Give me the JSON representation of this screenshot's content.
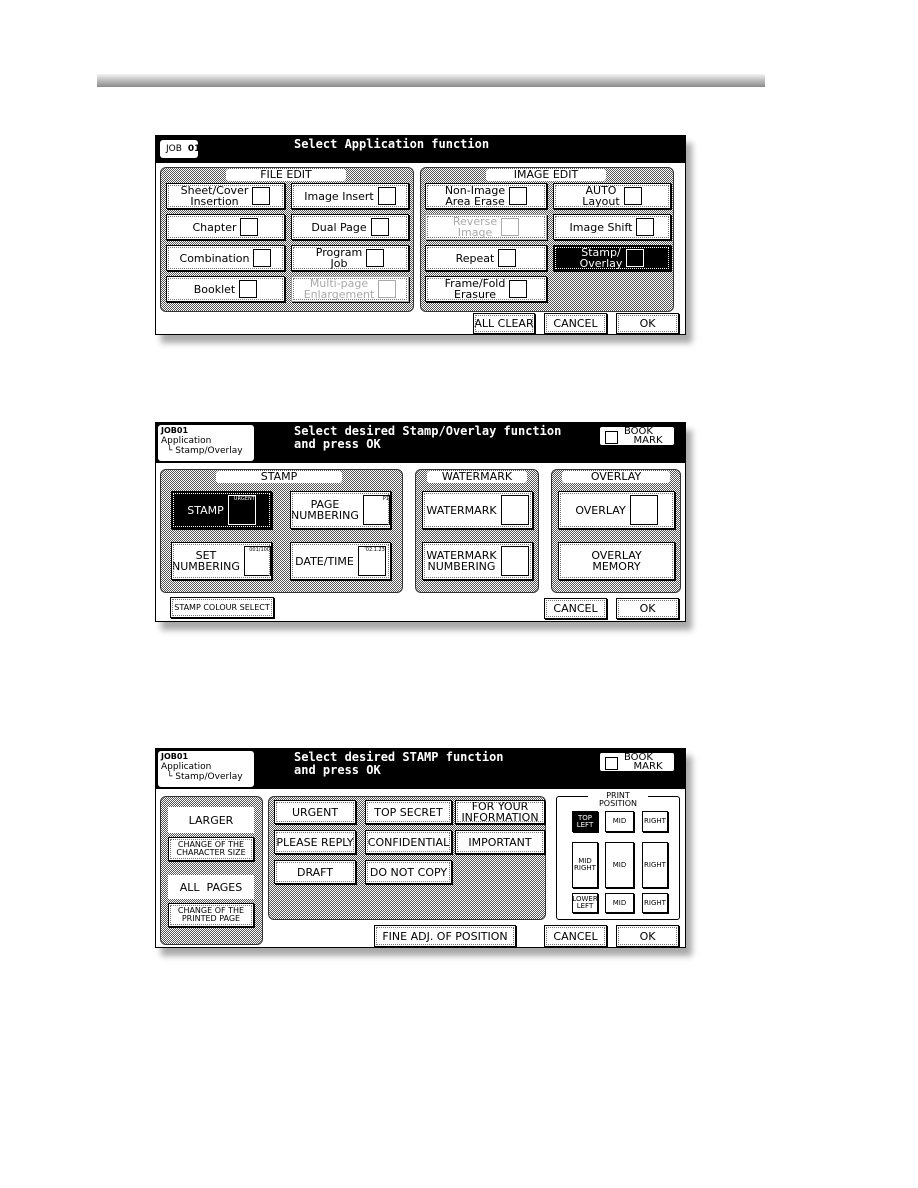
{
  "screen1": {
    "job_label": "JOB",
    "job_number": "01",
    "title": "Select Application function",
    "file_edit_label": "FILE EDIT",
    "image_edit_label": "IMAGE EDIT",
    "buttons": [
      {
        "label": "Sheet/Cover\nInsertion",
        "icon": "sheet-cover-icon",
        "state": "normal"
      },
      {
        "label": "Image Insert",
        "icon": "image-insert-icon",
        "state": "normal"
      },
      {
        "label": "Chapter",
        "icon": "chapter-icon",
        "state": "normal"
      },
      {
        "label": "Dual Page",
        "icon": "dual-page-icon",
        "state": "normal"
      },
      {
        "label": "Combination",
        "icon": "combination-icon",
        "state": "normal"
      },
      {
        "label": "Program\nJob",
        "icon": "program-job-icon",
        "state": "normal"
      },
      {
        "label": "Booklet",
        "icon": "booklet-icon",
        "state": "normal"
      },
      {
        "label": "Multi-page\nEnlargement",
        "icon": "multi-page-icon",
        "state": "disabled"
      },
      {
        "label": "Non-Image\nArea Erase",
        "icon": "non-image-erase-icon",
        "state": "normal"
      },
      {
        "label": "AUTO\nLayout",
        "icon": "auto-layout-icon",
        "state": "normal"
      },
      {
        "label": "Reverse\nImage",
        "icon": "reverse-image-icon",
        "state": "disabled"
      },
      {
        "label": "Image Shift",
        "icon": "image-shift-icon",
        "state": "normal"
      },
      {
        "label": "Repeat",
        "icon": "repeat-icon",
        "state": "normal"
      },
      {
        "label": "Stamp/\nOverlay",
        "icon": "stamp-overlay-icon",
        "state": "selected"
      },
      {
        "label": "Frame/Fold\nErasure",
        "icon": "frame-fold-icon",
        "state": "normal"
      }
    ],
    "all_clear": "ALL CLEAR",
    "cancel": "CANCEL",
    "ok": "OK"
  },
  "screen2": {
    "job": "JOB01",
    "breadcrumb_root": "Application",
    "breadcrumb_child": "└ Stamp/Overlay",
    "title": "Select desired Stamp/Overlay function\nand press OK",
    "bookmark": "BOOK\n   MARK",
    "stamp_label": "STAMP",
    "watermark_label": "WATERMARK",
    "overlay_label": "OVERLAY",
    "buttons": [
      {
        "label": "STAMP",
        "icon_text": "URGENT",
        "state": "selected"
      },
      {
        "label": "PAGE\nNUMBERING",
        "icon_text": "P1",
        "state": "normal"
      },
      {
        "label": "SET\nNUMBERING",
        "icon_text": "001/100",
        "state": "normal"
      },
      {
        "label": "DATE/TIME",
        "icon_text": "'02.1.23",
        "state": "normal"
      },
      {
        "label": "WATERMARK",
        "icon_text": "",
        "state": "normal"
      },
      {
        "label": "WATERMARK\nNUMBERING",
        "icon_text": "",
        "state": "normal"
      },
      {
        "label": "OVERLAY",
        "icon_text": "",
        "state": "normal"
      },
      {
        "label": "OVERLAY\nMEMORY",
        "icon_text": "",
        "state": "normal"
      }
    ],
    "stamp_colour": "STAMP COLOUR SELECT",
    "cancel": "CANCEL",
    "ok": "OK"
  },
  "screen3": {
    "job": "JOB01",
    "breadcrumb_root": "Application",
    "breadcrumb_child": "└ Stamp/Overlay",
    "title": "Select desired STAMP function\nand press OK",
    "bookmark": "BOOK\n   MARK",
    "size_value": "LARGER",
    "size_button": "CHANGE OF THE\nCHARACTER SIZE",
    "page_value": "ALL  PAGES",
    "page_button": "CHANGE OF THE\nPRINTED PAGE",
    "stamps": [
      {
        "label": "URGENT"
      },
      {
        "label": "TOP SECRET"
      },
      {
        "label": "FOR YOUR\nINFORMATION"
      },
      {
        "label": "PLEASE REPLY"
      },
      {
        "label": "CONFIDENTIAL"
      },
      {
        "label": "IMPORTANT"
      },
      {
        "label": "DRAFT"
      },
      {
        "label": "DO NOT COPY"
      }
    ],
    "print_position_label": "PRINT\nPOSITION",
    "positions": [
      {
        "label": "TOP\nLEFT",
        "state": "selected"
      },
      {
        "label": "MID",
        "state": "normal"
      },
      {
        "label": "RIGHT",
        "state": "normal"
      },
      {
        "label": "MID\nRIGHT",
        "state": "normal"
      },
      {
        "label": "MID",
        "state": "normal"
      },
      {
        "label": "RIGHT",
        "state": "normal"
      },
      {
        "label": "LOWER\nLEFT",
        "state": "normal"
      },
      {
        "label": "MID",
        "state": "normal"
      },
      {
        "label": "RIGHT",
        "state": "normal"
      }
    ],
    "fine_adj": "FINE ADJ. OF POSITION",
    "cancel": "CANCEL",
    "ok": "OK"
  }
}
